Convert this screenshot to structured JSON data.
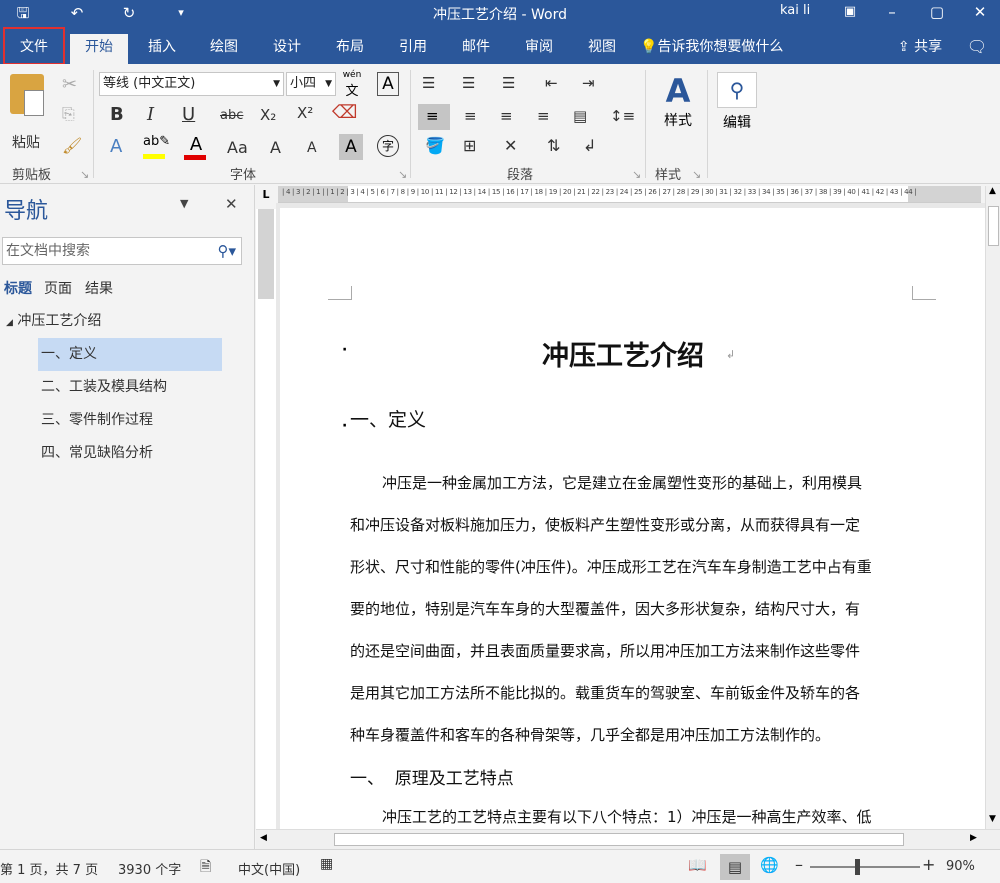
{
  "window": {
    "title": "冲压工艺介绍  -  Word",
    "user": "kai li",
    "minimize": "–",
    "restore": "▢",
    "close": "✕",
    "ribbon_options": "▣"
  },
  "quick_access": {
    "save": "🖫",
    "undo": "↶",
    "redo": "↻",
    "customize": "▾"
  },
  "tabs": [
    "文件",
    "开始",
    "插入",
    "绘图",
    "设计",
    "布局",
    "引用",
    "邮件",
    "审阅",
    "视图"
  ],
  "tell_me": "告诉我你想要做什么",
  "share": "共享",
  "ribbon": {
    "clipboard": {
      "paste": "粘贴",
      "label": "剪贴板"
    },
    "font": {
      "name": "等线 (中文正文)",
      "size": "小四",
      "wen": "wén",
      "wen_char": "文",
      "A_box": "A",
      "label": "字体",
      "bold": "B",
      "italic": "I",
      "underline": "U",
      "strike": "abc",
      "sub": "X₂",
      "sup": "X²",
      "font_color_a": "A",
      "change_case": "Aa",
      "grow": "A",
      "shrink": "A",
      "char_shading": "A",
      "enclose": "字"
    },
    "paragraph": {
      "label": "段落"
    },
    "styles": {
      "label": "样式",
      "button": "样式"
    },
    "editing": {
      "button": "编辑"
    }
  },
  "nav": {
    "title": "导航",
    "search_placeholder": "在文档中搜索",
    "tabs": [
      "标题",
      "页面",
      "结果"
    ],
    "root": "冲压工艺介绍",
    "items": [
      "一、定义",
      "二、工装及模具结构",
      "三、零件制作过程",
      "四、常见缺陷分析"
    ]
  },
  "ruler_numbers": "| 4 | 3 | 2 | 1 |    | 1 | 2 | 3 | 4 | 5 | 6 | 7 | 8 | 9 | 10 | 11 | 12 | 13 | 14 | 15 | 16 | 17 | 18 | 19 | 20 | 21 | 22 | 23 | 24 | 25 | 26 | 27 | 28 | 29 | 30 | 31 | 32 | 33 | 34 | 35 | 36 | 37 | 38 | 39 | 40 | 41 | 42 | 43 | 44 |",
  "doc": {
    "title": "冲压工艺介绍",
    "heading1": "一、定义",
    "para_lines": [
      "冲压是一种金属加工方法，它是建立在金属塑性变形的基础上，利用模具",
      "和冲压设备对板料施加压力，使板料产生塑性变形或分离，从而获得具有一定",
      "形状、尺寸和性能的零件(冲压件)。冲压成形工艺在汽车车身制造工艺中占有重",
      "要的地位，特别是汽车车身的大型覆盖件，因大多形状复杂，结构尺寸大，有",
      "的还是空间曲面，并且表面质量要求高，所以用冲压加工方法来制作这些零件",
      "是用其它加工方法所不能比拟的。载重货车的驾驶室、车前钣金件及轿车的各",
      "种车身覆盖件和客车的各种骨架等，几乎全都是用冲压加工方法制作的。"
    ],
    "heading2": "一、  原理及工艺特点",
    "para2_line": "冲压工艺的工艺特点主要有以下八个特点：1）冲压是一种高生产效率、低"
  },
  "status": {
    "page": "第 1 页，共 7 页",
    "words": "3930 个字",
    "lang": "中文(中国)",
    "zoom": "90%"
  }
}
